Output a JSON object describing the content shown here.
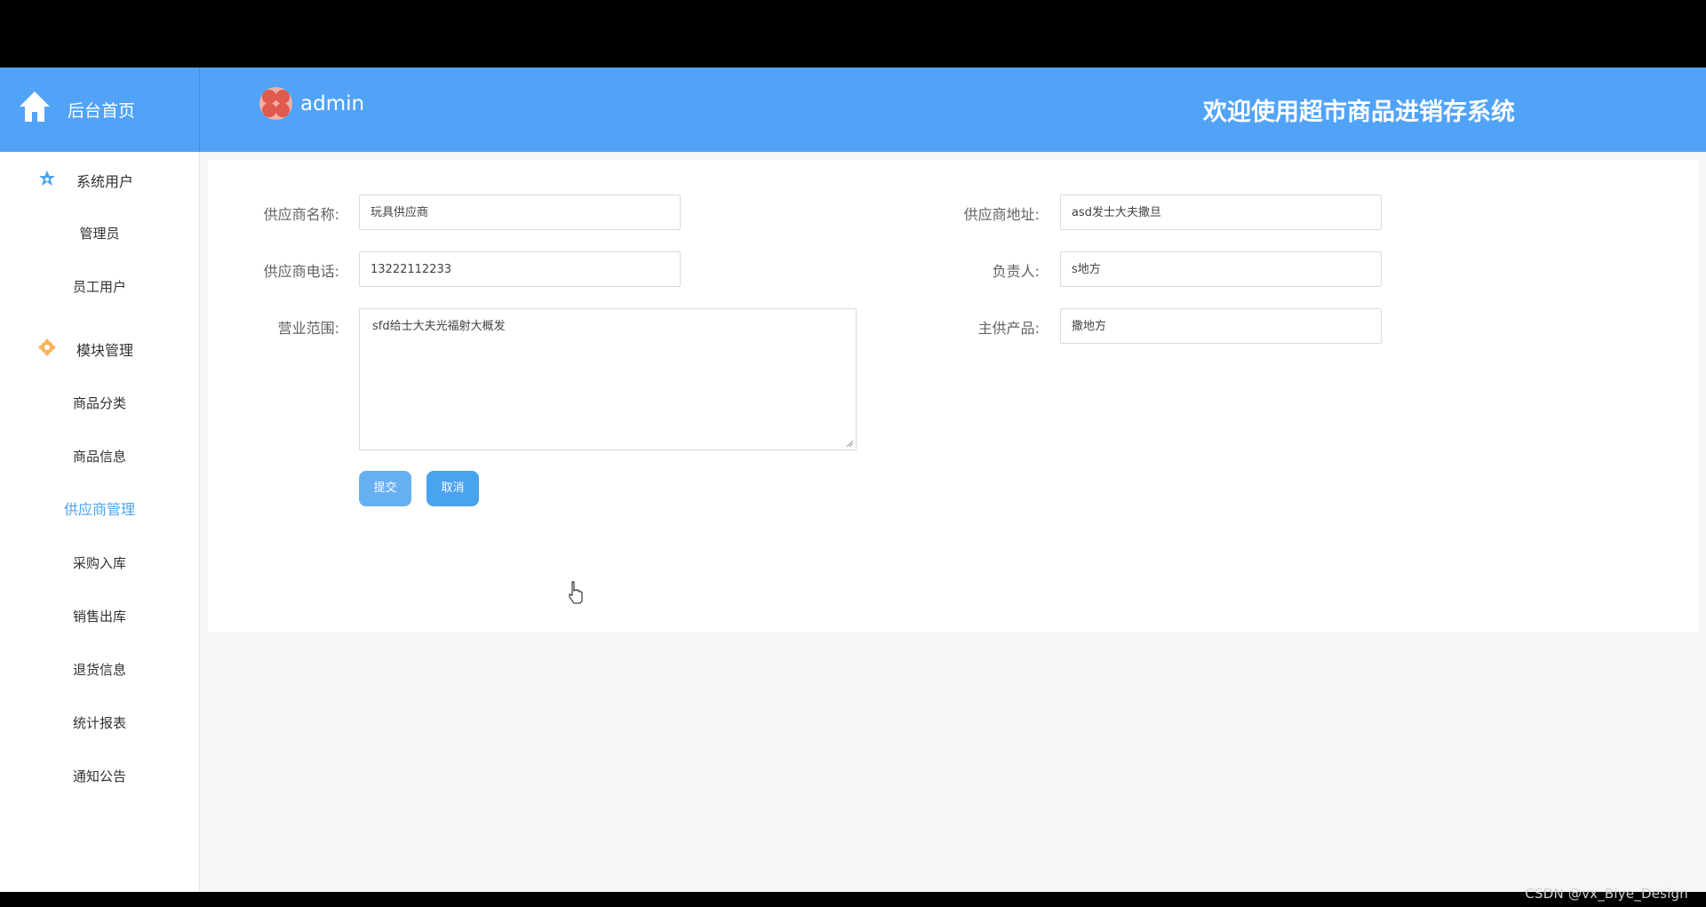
{
  "topbar": {
    "home_label": "后台首页",
    "user_name": "admin",
    "welcome": "欢迎使用超市商品进销存系统",
    "background_color": "#51a3f8"
  },
  "sidebar": {
    "groups": [
      {
        "label": "系统用户",
        "icon": "star-icon",
        "icon_color": "#4aa3ef"
      },
      {
        "label": "模块管理",
        "icon": "gear-icon",
        "icon_color": "#f7b35d"
      }
    ],
    "items": [
      {
        "label": "管理员"
      },
      {
        "label": "员工用户"
      },
      {
        "label": "商品分类"
      },
      {
        "label": "商品信息"
      },
      {
        "label": "供应商管理",
        "active": true
      },
      {
        "label": "采购入库"
      },
      {
        "label": "销售出库"
      },
      {
        "label": "退货信息"
      },
      {
        "label": "统计报表"
      },
      {
        "label": "通知公告"
      }
    ]
  },
  "form": {
    "supplier_name": {
      "label": "供应商名称:",
      "value": "玩具供应商"
    },
    "supplier_address": {
      "label": "供应商地址:",
      "value": "asd发士大夫撒旦"
    },
    "supplier_phone": {
      "label": "供应商电话:",
      "value": "13222112233"
    },
    "contact_person": {
      "label": "负责人:",
      "value": "s地方"
    },
    "business_scope": {
      "label": "营业范围:",
      "value": "sfd给士大夫光福射大概发"
    },
    "main_product": {
      "label": "主供产品:",
      "value": "撒地方"
    },
    "submit_label": "提交",
    "cancel_label": "取消"
  },
  "watermark": "CSDN @vx_Biye_Design"
}
